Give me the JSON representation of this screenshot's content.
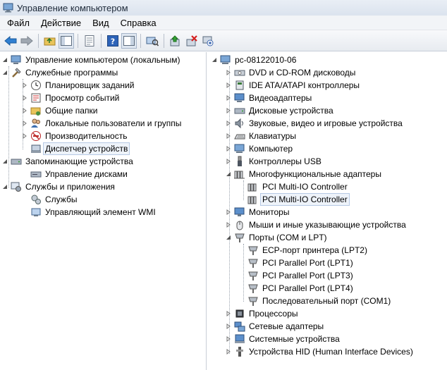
{
  "window": {
    "title": "Управление компьютером"
  },
  "menu": [
    "Файл",
    "Действие",
    "Вид",
    "Справка"
  ],
  "left_tree": {
    "root": "Управление компьютером (локальным)",
    "utilities": "Служебные программы",
    "task_scheduler": "Планировщик заданий",
    "event_viewer": "Просмотр событий",
    "shared_folders": "Общие папки",
    "local_users": "Локальные пользователи и группы",
    "performance": "Производительность",
    "device_manager": "Диспетчер устройств",
    "storage": "Запоминающие устройства",
    "disk_management": "Управление дисками",
    "services_apps": "Службы и приложения",
    "services": "Службы",
    "wmi": "Управляющий элемент WMI"
  },
  "right_tree": {
    "root": "pc-08122010-06",
    "dvd": "DVD и CD-ROM дисководы",
    "ide": "IDE ATA/ATAPI контроллеры",
    "video": "Видеоадаптеры",
    "disks": "Дисковые устройства",
    "sound": "Звуковые, видео и игровые устройства",
    "keyboards": "Клавиатуры",
    "computer": "Компьютер",
    "usb": "Контроллеры USB",
    "multi": "Многофункциональные адаптеры",
    "multi_children": [
      "PCI Multi-IO Controller",
      "PCI Multi-IO Controller"
    ],
    "monitors": "Мониторы",
    "mice": "Мыши и иные указывающие устройства",
    "ports": "Порты (COM и LPT)",
    "ports_children": [
      "ECP-порт принтера (LPT2)",
      "PCI Parallel Port (LPT1)",
      "PCI Parallel Port (LPT3)",
      "PCI Parallel Port (LPT4)",
      "Последовательный порт (COM1)"
    ],
    "cpus": "Процессоры",
    "network": "Сетевые адаптеры",
    "system": "Системные устройства",
    "hid": "Устройства HID (Human Interface Devices)"
  }
}
